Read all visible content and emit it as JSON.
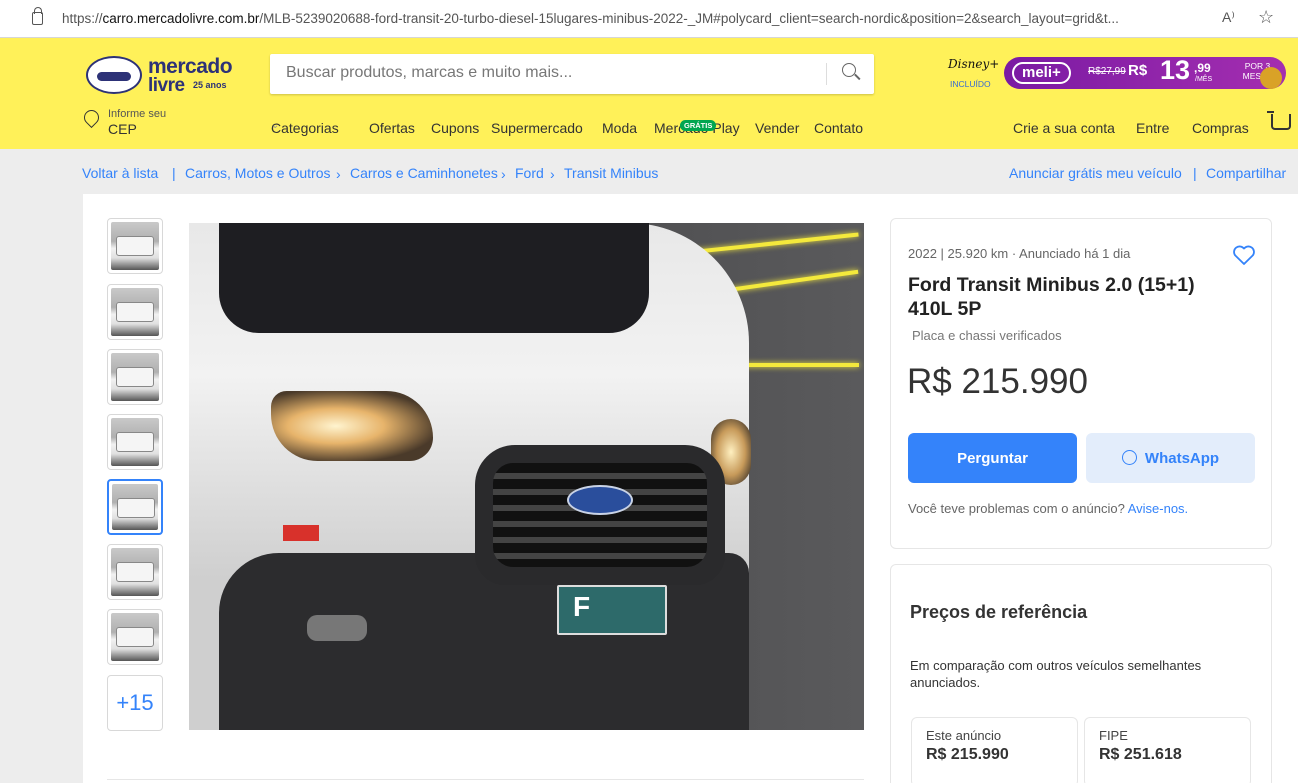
{
  "browser": {
    "url_prefix": "https://",
    "url_domain": "carro.mercadolivre.com.br",
    "url_rest": "/MLB-5239020688-ford-transit-20-turbo-diesel-15lugares-minibus-2022-_JM#polycard_client=search-nordic&position=2&search_layout=grid&t...",
    "read_aloud": "A⁾",
    "favorite": "☆"
  },
  "header": {
    "logo_line1": "mercado",
    "logo_line2": "livre",
    "logo_anos": "25 anos",
    "search_placeholder": "Buscar produtos, marcas e muito mais...",
    "promo": {
      "disney": "Disney+",
      "incluido": "INCLUÍDO",
      "meli": "meli+",
      "old_price": "R$27,99",
      "rs": "R$",
      "price": "13",
      "cents": ",99",
      "per_month": "/MÊS",
      "period": "POR 3 MESES"
    },
    "cep_line1": "Informe seu",
    "cep_line2": "CEP",
    "nav": [
      "Categorias",
      "Ofertas",
      "Cupons",
      "Supermercado",
      "Moda",
      "Mercado Play",
      "Vender",
      "Contato"
    ],
    "gratis_badge": "GRÁTIS",
    "account": [
      "Crie a sua conta",
      "Entre",
      "Compras"
    ]
  },
  "breadcrumb": {
    "back": "Voltar à lista",
    "items": [
      "Carros, Motos e Outros",
      "Carros e Caminhonetes",
      "Ford",
      "Transit Minibus"
    ],
    "right": [
      "Anunciar grátis meu veículo",
      "Compartilhar"
    ]
  },
  "gallery": {
    "more_label": "+15"
  },
  "listing": {
    "meta": "2022 | 25.920 km · Anunciado há 1 dia",
    "title": "Ford Transit Minibus 2.0 (15+1) 410L 5P",
    "verified": "Placa e chassi verificados",
    "price": "R$ 215.990",
    "ask_button": "Perguntar",
    "whatsapp_button": "WhatsApp",
    "problem_text": "Você teve problemas com o anúncio?",
    "problem_link": "Avise-nos."
  },
  "reference": {
    "title": "Preços de referência",
    "description": "Em comparação com outros veículos semelhantes anunciados.",
    "cells": [
      {
        "label": "Este anúncio",
        "value": "R$ 215.990"
      },
      {
        "label": "FIPE",
        "value": "R$ 251.618"
      }
    ]
  },
  "colors": {
    "header_yellow": "#fff159",
    "accent_blue": "#3483fa",
    "meli_purple": "#7a1aa3"
  }
}
